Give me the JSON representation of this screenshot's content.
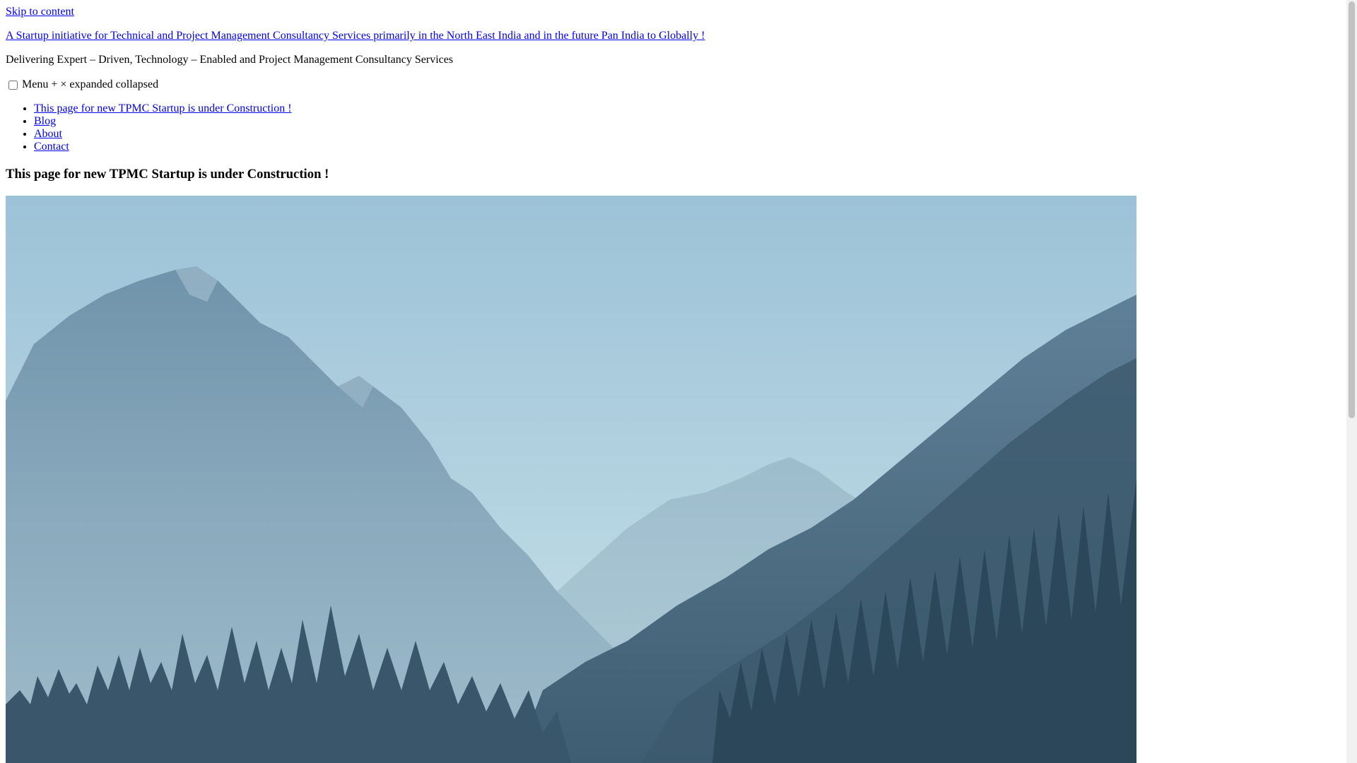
{
  "skip_link": "Skip to content",
  "site_title": "A Startup initiative for Technical and Project Management Consultancy Services primarily in the North East India and in the future Pan India to Globally !",
  "tagline": "Delivering Expert – Driven, Technology – Enabled and Project Management Consultancy Services",
  "menu_toggle": {
    "label": "Menu + × expanded collapsed",
    "checked": false
  },
  "nav": {
    "items": [
      {
        "label": "This page for new TPMC Startup is under Construction !"
      },
      {
        "label": "Blog"
      },
      {
        "label": "About"
      },
      {
        "label": "Contact"
      }
    ]
  },
  "page": {
    "heading": "This page for new TPMC Startup is under Construction !"
  },
  "hero_image": {
    "subject": "misty mountain range with pine forest",
    "colors": {
      "sky_top": "#9dc3d8",
      "sky_bottom": "#c4dde6",
      "far_mountain": "#a9c6d4",
      "mid_mountain": "#7fa2b8",
      "forest": "#4a6a80",
      "dark_forest": "#2f4a5e"
    }
  },
  "scrollbar": {
    "track_color": "#f1f1f1",
    "thumb_color": "#c1c1c1"
  }
}
